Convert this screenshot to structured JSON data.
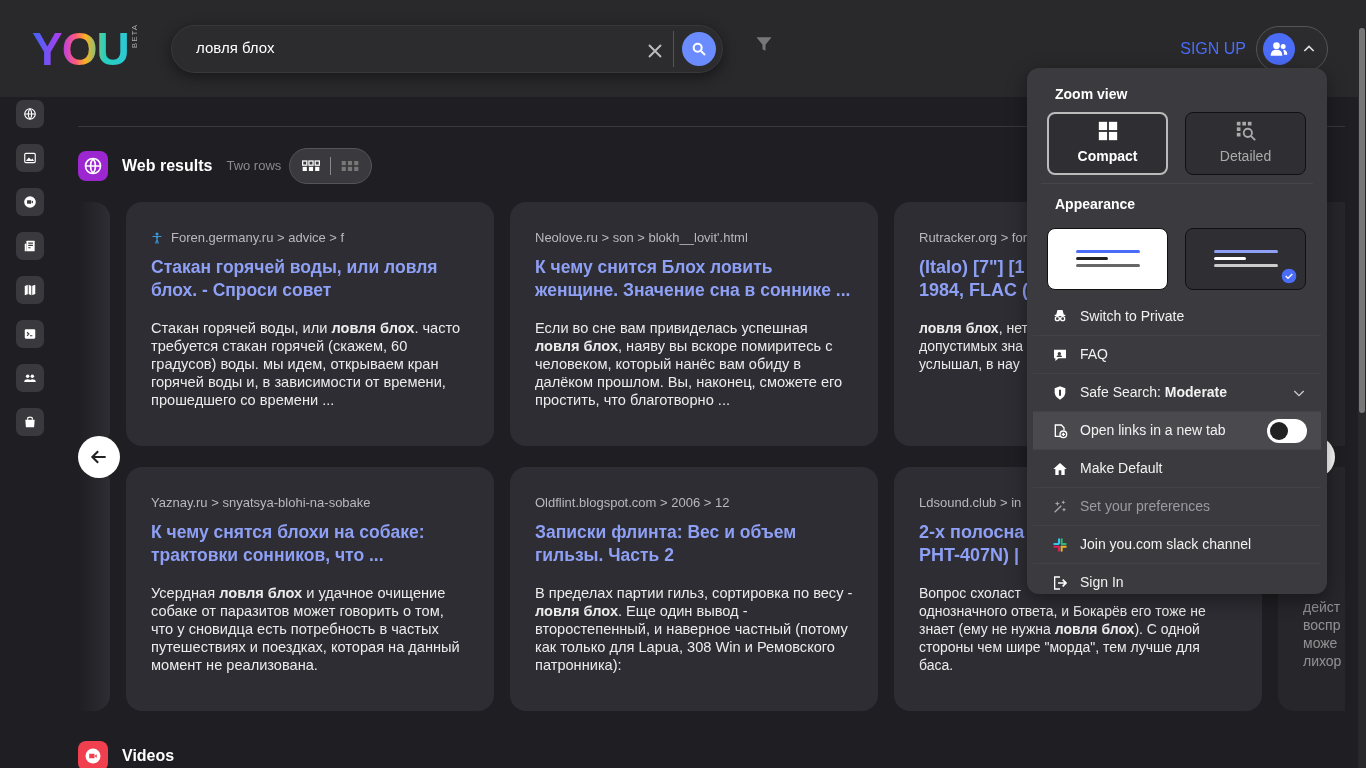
{
  "header": {
    "logo": "YOU",
    "logo_badge": "BETA",
    "search": {
      "value": "ловля блох"
    },
    "sign_up": "SIGN UP",
    "account_menu_expanded": true
  },
  "web_results": {
    "title": "Web results",
    "layout_label": "Two rows",
    "layout_options": [
      {
        "kind": "rows",
        "selected": true
      },
      {
        "kind": "grid",
        "selected": false
      }
    ],
    "rows": [
      [
        {
          "kind": "full",
          "favicon": true,
          "url": "Foren.germany.ru > advice > f",
          "title": "Стакан горячей воды, или ловля блох. - Спроси совет",
          "snippet": "Стакан горячей воды, или **ловля блох**. часто требуется стакан горячей (скажем, 60 градусов) воды. мы идем, открываем кран горячей воды и, в зависимости от времени, прошедшего со времени ..."
        },
        {
          "kind": "full",
          "url": "Neolove.ru > son > blokh__lovit'.html",
          "title": "К чему снится Блох ловить женщине. Значение сна в соннике ...",
          "snippet": "Если во сне вам привиделась успешная **ловля блох**, наяву вы вскоре помиритесь с человеком, который нанёс вам обиду в далёком прошлом. Вы, наконец, сможете его простить, что благотворно ..."
        },
        {
          "kind": "cut",
          "url": "Rutracker.org > for",
          "title_lines": [
            "(Italo) [7\"] [1",
            "1984, FLAC ("
          ],
          "snippet_lines": [
            "**ловля блох**, нет",
            "допустимых зна",
            "услышал, в нау"
          ]
        },
        {
          "kind": "cut"
        }
      ],
      [
        {
          "kind": "full",
          "url": "Yaznay.ru > snyatsya-blohi-na-sobake",
          "title": "К чему снятся блохи на собаке: трактовки сонников, что ...",
          "snippet": "Усердная **ловля блох** и удачное очищение собаке от паразитов может говорить о том, что у сновидца есть потребность в частых путешествиях и поездках, которая на данный момент не реализована."
        },
        {
          "kind": "full",
          "url": "Oldflint.blogspot.com > 2006 > 12",
          "title": "Записки флинта: Вес и объем гильзы. Часть 2",
          "snippet": "В пределах партии гильз, сортировка по весу - **ловля блох**. Еще один вывод - второстепенный, и наверное частный (потому как только для Lapua, 308 Win и Ремовского патронника):"
        },
        {
          "kind": "cut",
          "url": "Ldsound.club > in",
          "title_lines": [
            "2-х полосна",
            "PHT-407N) |"
          ],
          "snippet_lines": [
            "Вопрос схоласт",
            "однозначного ответа, и Бокарёв его тоже не",
            "знает (ему не нужна **ловля блох**). С одной",
            "стороны чем шире \"морда\", тем лучше для",
            "баса."
          ]
        },
        {
          "kind": "cut",
          "snippet_lines": [
            "дейст",
            "воспр",
            "може",
            "лихор"
          ]
        }
      ]
    ]
  },
  "videos": {
    "title": "Videos"
  },
  "menu": {
    "zoom_title": "Zoom view",
    "zoom_options": [
      {
        "label": "Compact",
        "selected": true
      },
      {
        "label": "Detailed",
        "selected": false
      }
    ],
    "appearance_title": "Appearance",
    "appearance_options": [
      {
        "kind": "light",
        "selected": false
      },
      {
        "kind": "dark",
        "selected": true
      }
    ],
    "items": [
      {
        "kind": "link",
        "label": "Switch to Private",
        "disabled": false,
        "hovered": false
      },
      {
        "kind": "link",
        "label": "FAQ",
        "disabled": false,
        "hovered": false
      },
      {
        "kind": "dropdown",
        "label": "Safe Search: **Moderate**",
        "disabled": false,
        "hovered": false
      },
      {
        "kind": "toggle",
        "label": "Open links in a new tab",
        "on": false,
        "disabled": false,
        "hovered": true
      },
      {
        "kind": "link",
        "label": "Make Default",
        "disabled": false,
        "hovered": false
      },
      {
        "kind": "link",
        "label": "Set your preferences",
        "disabled": true,
        "hovered": false
      },
      {
        "kind": "link",
        "label": "Join you.com slack channel",
        "disabled": false,
        "hovered": false
      },
      {
        "kind": "link",
        "label": "Sign In",
        "disabled": false,
        "hovered": false
      }
    ]
  }
}
